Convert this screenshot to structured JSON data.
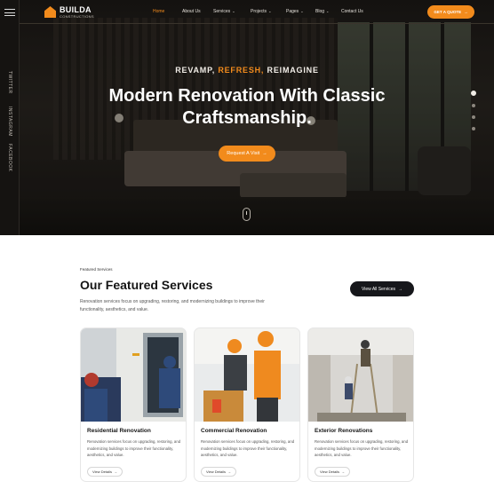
{
  "brand": {
    "name": "BUILDA",
    "tagline": "CONSTRUCTIONS",
    "accent": "#f28b1c",
    "dark": "#16171b"
  },
  "sidebar": {
    "menu_icon": "hamburger-icon",
    "social": [
      "TWITTER",
      "INSTAGRAM",
      "FACEBOOK"
    ]
  },
  "nav": {
    "items": [
      {
        "label": "Home",
        "active": true
      },
      {
        "label": "About Us",
        "active": false
      },
      {
        "label": "Services",
        "has_dropdown": true
      },
      {
        "label": "Projects",
        "has_dropdown": true
      },
      {
        "label": "Pages",
        "has_dropdown": true
      },
      {
        "label": "Blog",
        "has_dropdown": true
      },
      {
        "label": "Contact Us",
        "active": false
      }
    ],
    "quote_button": "GET A QUOTE",
    "chevron": "⌄",
    "arrow": "→"
  },
  "hero": {
    "eyebrow_1": "REVAMP,",
    "eyebrow_2": "REFRESH,",
    "eyebrow_3": "REIMAGINE",
    "title": "Modern Renovation With Classic Craftsmanship.",
    "button": "Request A Visit",
    "slides": 4,
    "active_slide": 1
  },
  "featured": {
    "tag": "Featured Services",
    "title": "Our Featured Services",
    "description": "Renovation services focus on upgrading, restoring, and modernizing buildings to improve their functionality, aesthetics, and value.",
    "all_button": "View All Services",
    "cards": [
      {
        "title": "Residential Renovation",
        "description": "Renovation services focus on upgrading, restoring, and modernizing buildings to improve their functionality, aesthetics, and value.",
        "button": "View Details"
      },
      {
        "title": "Commercial Renovation",
        "description": "Renovation services focus on upgrading, restoring, and modernizing buildings to improve their functionality, aesthetics, and value.",
        "button": "View Details"
      },
      {
        "title": "Exterior Renovations",
        "description": "Renovation services focus on upgrading, restoring, and modernizing buildings to improve their functionality, aesthetics, and value.",
        "button": "View Details"
      }
    ]
  }
}
